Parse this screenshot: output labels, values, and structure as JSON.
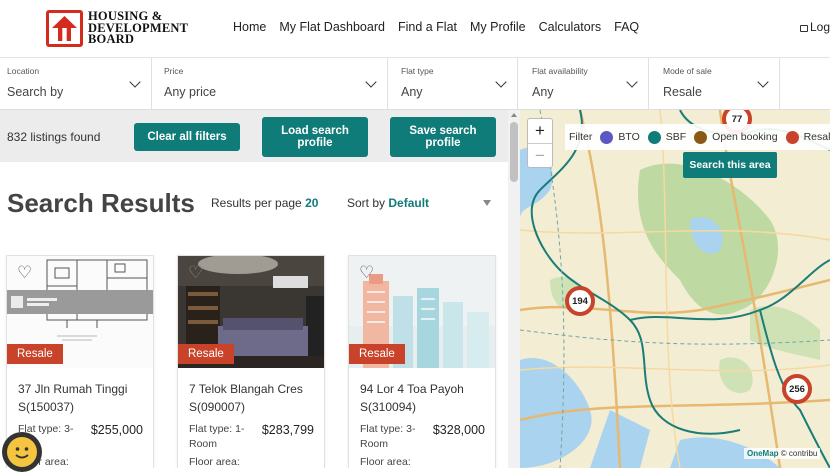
{
  "header": {
    "logo_text": [
      "HOUSING &",
      "DEVELOPMENT",
      "BOARD"
    ],
    "nav": [
      "Home",
      "My Flat Dashboard",
      "Find a Flat",
      "My Profile",
      "Calculators",
      "FAQ"
    ],
    "login": "Logi"
  },
  "filters": [
    {
      "label": "Location",
      "value": "Search by"
    },
    {
      "label": "Price",
      "value": "Any price"
    },
    {
      "label": "Flat type",
      "value": "Any"
    },
    {
      "label": "Flat availability",
      "value": "Any"
    },
    {
      "label": "Mode of sale",
      "value": "Resale"
    }
  ],
  "toolbar": {
    "count": "832 listings found",
    "clear": "Clear all filters",
    "load": "Load search profile",
    "save": "Save search profile"
  },
  "results": {
    "title": "Search Results",
    "per_page_label": "Results per page",
    "per_page_value": "20",
    "sort_label": "Sort by",
    "sort_value": "Default"
  },
  "listings": [
    {
      "badge": "Resale",
      "address": "37 Jln Rumah Tinggi S(150037)",
      "flat_type": "Flat type: 3-",
      "price": "$255,000",
      "floor_area": "Floor area:"
    },
    {
      "badge": "Resale",
      "address": "7 Telok Blangah Cres S(090007)",
      "flat_type": "Flat type: 1-Room",
      "price": "$283,799",
      "floor_area": "Floor area:"
    },
    {
      "badge": "Resale",
      "address": "94 Lor 4 Toa Payoh S(310094)",
      "flat_type": "Flat type: 3-Room",
      "price": "$328,000",
      "floor_area": "Floor area:"
    }
  ],
  "map": {
    "zoom_in": "+",
    "zoom_out": "−",
    "legend_label": "Filter",
    "legend": [
      {
        "name": "BTO",
        "color": "#5b57c4"
      },
      {
        "name": "SBF",
        "color": "#0f7c79"
      },
      {
        "name": "Open booking",
        "color": "#8a5a14"
      },
      {
        "name": "Resale",
        "color": "#c9432b"
      }
    ],
    "search_area": "Search this area",
    "clusters": [
      "77",
      "194",
      "256"
    ],
    "attribution_brand": "OneMap",
    "attribution_rest": "© contribu"
  }
}
